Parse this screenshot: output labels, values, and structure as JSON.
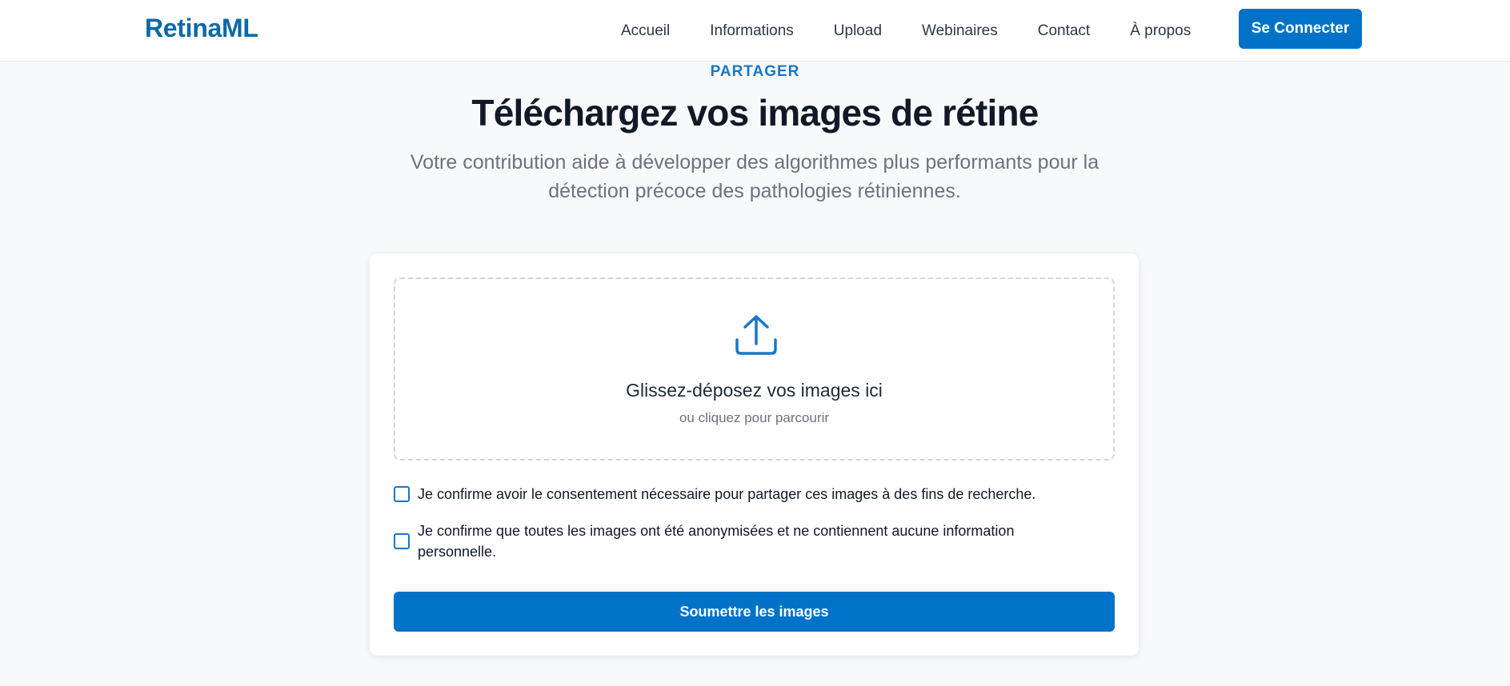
{
  "navbar": {
    "brand": "RetinaML",
    "links": [
      {
        "label": "Accueil"
      },
      {
        "label": "Informations"
      },
      {
        "label": "Upload"
      },
      {
        "label": "Webinaires"
      },
      {
        "label": "Contact"
      },
      {
        "label": "À propos"
      }
    ],
    "login_label": "Se Connecter"
  },
  "hero": {
    "eyebrow": "PARTAGER",
    "title": "Téléchargez vos images de rétine",
    "subtitle": "Votre contribution aide à développer des algorithmes plus performants pour la détection précoce des pathologies rétiniennes."
  },
  "upload": {
    "icon": "upload-icon",
    "dropzone_title": "Glissez-déposez vos images ici",
    "dropzone_subtitle": "ou cliquez pour parcourir",
    "consent_label": "Je confirme avoir le consentement nécessaire pour partager ces images à des fins de recherche.",
    "anonymized_label": "Je confirme que toutes les images ont été anonymisées et ne contiennent aucune information personnelle.",
    "consent_checked": false,
    "anonymized_checked": false,
    "submit_label": "Soumettre les images"
  },
  "colors": {
    "accent": "#0073c8",
    "brand": "#0a6aa6",
    "background": "#f8f9fa"
  }
}
